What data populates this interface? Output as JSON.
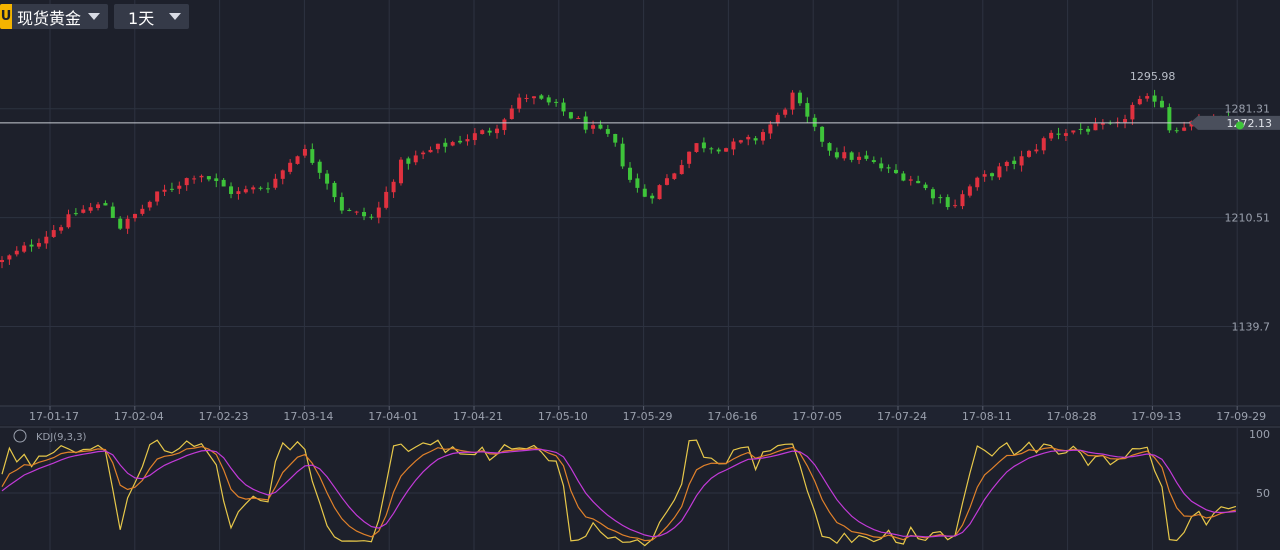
{
  "toolbar": {
    "symbol_badge": "U",
    "symbol_label": "现货黄金",
    "period_label": "1天"
  },
  "indicator": {
    "label": "KDJ(9,3,3)",
    "levels": [
      "100",
      "50"
    ]
  },
  "colors": {
    "background": "#1d202b",
    "grid": "#2d3240",
    "up": "#e0313f",
    "down": "#3ec43a",
    "price_line": "#c9ccd4",
    "k_line": "#e7c84a",
    "d_line": "#e0812a",
    "j_line": "#c23ad8"
  },
  "chart_data": {
    "type": "candlestick",
    "price_axis": {
      "ylim": [
        1088,
        1352
      ],
      "ticks": [
        "1281.31",
        "1210.51",
        "1139.7"
      ],
      "tick_values": [
        1281.31,
        1210.51,
        1139.7
      ],
      "current_value": 1272.13,
      "current_label": "1272.13",
      "max_label": "1295.98",
      "max_value": 1295.98
    },
    "x_axis": {
      "labels": [
        "17-01-17",
        "17-02-04",
        "17-02-23",
        "17-03-14",
        "17-04-01",
        "17-04-21",
        "17-05-10",
        "17-05-29",
        "17-06-16",
        "17-07-05",
        "17-07-24",
        "17-08-11",
        "17-08-28",
        "17-09-13",
        "17-09-29"
      ],
      "days_total": 240,
      "days_shown": 168
    },
    "anchors": [
      [
        0,
        1182
      ],
      [
        8,
        1198
      ],
      [
        15,
        1215
      ],
      [
        20,
        1219
      ],
      [
        23,
        1204
      ],
      [
        30,
        1225
      ],
      [
        38,
        1240
      ],
      [
        45,
        1226
      ],
      [
        52,
        1232
      ],
      [
        58,
        1256
      ],
      [
        62,
        1240
      ],
      [
        66,
        1215
      ],
      [
        72,
        1210
      ],
      [
        77,
        1245
      ],
      [
        85,
        1257
      ],
      [
        95,
        1268
      ],
      [
        101,
        1290
      ],
      [
        107,
        1283
      ],
      [
        113,
        1270
      ],
      [
        118,
        1262
      ],
      [
        122,
        1232
      ],
      [
        125,
        1223
      ],
      [
        130,
        1240
      ],
      [
        134,
        1258
      ],
      [
        140,
        1256
      ],
      [
        146,
        1262
      ],
      [
        150,
        1275
      ],
      [
        153,
        1290
      ],
      [
        157,
        1268
      ],
      [
        161,
        1252
      ],
      [
        167,
        1248
      ],
      [
        172,
        1240
      ],
      [
        176,
        1236
      ],
      [
        180,
        1226
      ],
      [
        184,
        1218
      ],
      [
        188,
        1233
      ],
      [
        193,
        1242
      ],
      [
        198,
        1250
      ],
      [
        203,
        1265
      ],
      [
        209,
        1268
      ],
      [
        216,
        1270
      ],
      [
        219,
        1284
      ],
      [
        224,
        1289
      ],
      [
        226,
        1268
      ],
      [
        230,
        1272
      ]
    ],
    "kdj_range": [
      0,
      100
    ]
  }
}
